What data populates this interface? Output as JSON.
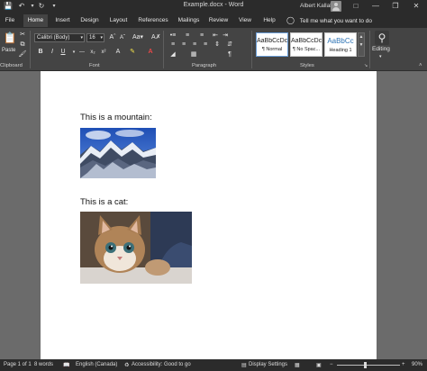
{
  "title_bar": {
    "save_icon": "save-icon",
    "undo_icon": "undo-icon",
    "redo_icon": "redo-icon",
    "customize_icon": "customize-quick-access-icon",
    "document_title": "Example.docx - Word",
    "user_name": "Albert Kallal",
    "window_controls": [
      "ribbon-options-icon",
      "minimize-icon",
      "restore-icon",
      "close-icon"
    ]
  },
  "tabs": [
    {
      "label": "File"
    },
    {
      "label": "Home",
      "active": true
    },
    {
      "label": "Insert"
    },
    {
      "label": "Design"
    },
    {
      "label": "Layout"
    },
    {
      "label": "References"
    },
    {
      "label": "Mailings"
    },
    {
      "label": "Review"
    },
    {
      "label": "View"
    },
    {
      "label": "Help"
    }
  ],
  "tell_me": "Tell me what you want to do",
  "ribbon": {
    "clipboard": {
      "label": "Clipboard",
      "paste_label": "Paste"
    },
    "font": {
      "label": "Font",
      "font_name": "Calibri (Body)",
      "font_size": "16",
      "format_buttons": [
        "B",
        "I",
        "U"
      ]
    },
    "paragraph": {
      "label": "Paragraph"
    },
    "styles": {
      "label": "Styles",
      "items": [
        {
          "sample": "AaBbCcDc",
          "name": "¶ Normal"
        },
        {
          "sample": "AaBbCcDc",
          "name": "¶ No Spac..."
        },
        {
          "sample": "AaBbCc",
          "name": "Heading 1"
        }
      ]
    },
    "editing": {
      "label": "Editing"
    }
  },
  "document": {
    "paragraph_1": "This is a mountain:",
    "paragraph_2": "This is a cat:"
  },
  "status": {
    "page": "Page 1 of 1",
    "words": "8 words",
    "language": "English (Canada)",
    "accessibility": "Accessibility: Good to go",
    "display_settings": "Display Settings",
    "zoom": "90%",
    "zoom_level": 0.9
  },
  "colors": {
    "titlebar": "#2b2b2b",
    "ribbon": "#444444",
    "canvas": "#6b6b6b",
    "page": "#ffffff",
    "heading_accent": "#2e74b5"
  }
}
